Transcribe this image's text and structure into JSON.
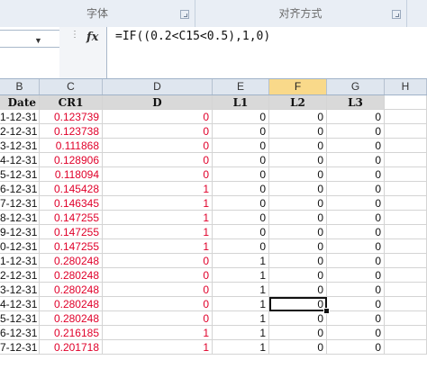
{
  "ribbon": {
    "groups": [
      {
        "label": "字体"
      },
      {
        "label": "对齐方式"
      }
    ]
  },
  "formula_bar": {
    "namebox_value": "",
    "fx_label": "fx",
    "formula": "=IF((0.2<C15<0.5),1,0)"
  },
  "columns": [
    {
      "letter": "B",
      "header": "Date"
    },
    {
      "letter": "C",
      "header": "CR1"
    },
    {
      "letter": "D",
      "header": "D"
    },
    {
      "letter": "E",
      "header": "L1"
    },
    {
      "letter": "F",
      "header": "L2",
      "selected": true
    },
    {
      "letter": "G",
      "header": "L3"
    },
    {
      "letter": "H",
      "header": ""
    }
  ],
  "rows": [
    {
      "date": "1-12-31",
      "cr1": "0.123739",
      "d": "0",
      "l1": "0",
      "l2": "0",
      "l3": "0"
    },
    {
      "date": "2-12-31",
      "cr1": "0.123738",
      "d": "0",
      "l1": "0",
      "l2": "0",
      "l3": "0"
    },
    {
      "date": "3-12-31",
      "cr1": "0.111868",
      "d": "0",
      "l1": "0",
      "l2": "0",
      "l3": "0"
    },
    {
      "date": "4-12-31",
      "cr1": "0.128906",
      "d": "0",
      "l1": "0",
      "l2": "0",
      "l3": "0"
    },
    {
      "date": "5-12-31",
      "cr1": "0.118094",
      "d": "0",
      "l1": "0",
      "l2": "0",
      "l3": "0"
    },
    {
      "date": "6-12-31",
      "cr1": "0.145428",
      "d": "1",
      "l1": "0",
      "l2": "0",
      "l3": "0"
    },
    {
      "date": "7-12-31",
      "cr1": "0.146345",
      "d": "1",
      "l1": "0",
      "l2": "0",
      "l3": "0"
    },
    {
      "date": "8-12-31",
      "cr1": "0.147255",
      "d": "1",
      "l1": "0",
      "l2": "0",
      "l3": "0"
    },
    {
      "date": "9-12-31",
      "cr1": "0.147255",
      "d": "1",
      "l1": "0",
      "l2": "0",
      "l3": "0"
    },
    {
      "date": "0-12-31",
      "cr1": "0.147255",
      "d": "1",
      "l1": "0",
      "l2": "0",
      "l3": "0"
    },
    {
      "date": "1-12-31",
      "cr1": "0.280248",
      "d": "0",
      "l1": "1",
      "l2": "0",
      "l3": "0"
    },
    {
      "date": "2-12-31",
      "cr1": "0.280248",
      "d": "0",
      "l1": "1",
      "l2": "0",
      "l3": "0"
    },
    {
      "date": "3-12-31",
      "cr1": "0.280248",
      "d": "0",
      "l1": "1",
      "l2": "0",
      "l3": "0"
    },
    {
      "date": "4-12-31",
      "cr1": "0.280248",
      "d": "0",
      "l1": "1",
      "l2": "0",
      "l3": "0",
      "active": "l2"
    },
    {
      "date": "5-12-31",
      "cr1": "0.280248",
      "d": "0",
      "l1": "1",
      "l2": "0",
      "l3": "0"
    },
    {
      "date": "6-12-31",
      "cr1": "0.216185",
      "d": "1",
      "l1": "1",
      "l2": "0",
      "l3": "0"
    },
    {
      "date": "7-12-31",
      "cr1": "0.201718",
      "d": "1",
      "l1": "1",
      "l2": "0",
      "l3": "0"
    }
  ],
  "colors": {
    "value_red": "#e0002a",
    "selected_col_header": "#f9d98a",
    "ribbon_bg": "#e9eef5"
  },
  "icons": {
    "dropdown": "chevron-down-icon",
    "function": "fx-icon",
    "launcher": "dialog-launcher-icon"
  }
}
